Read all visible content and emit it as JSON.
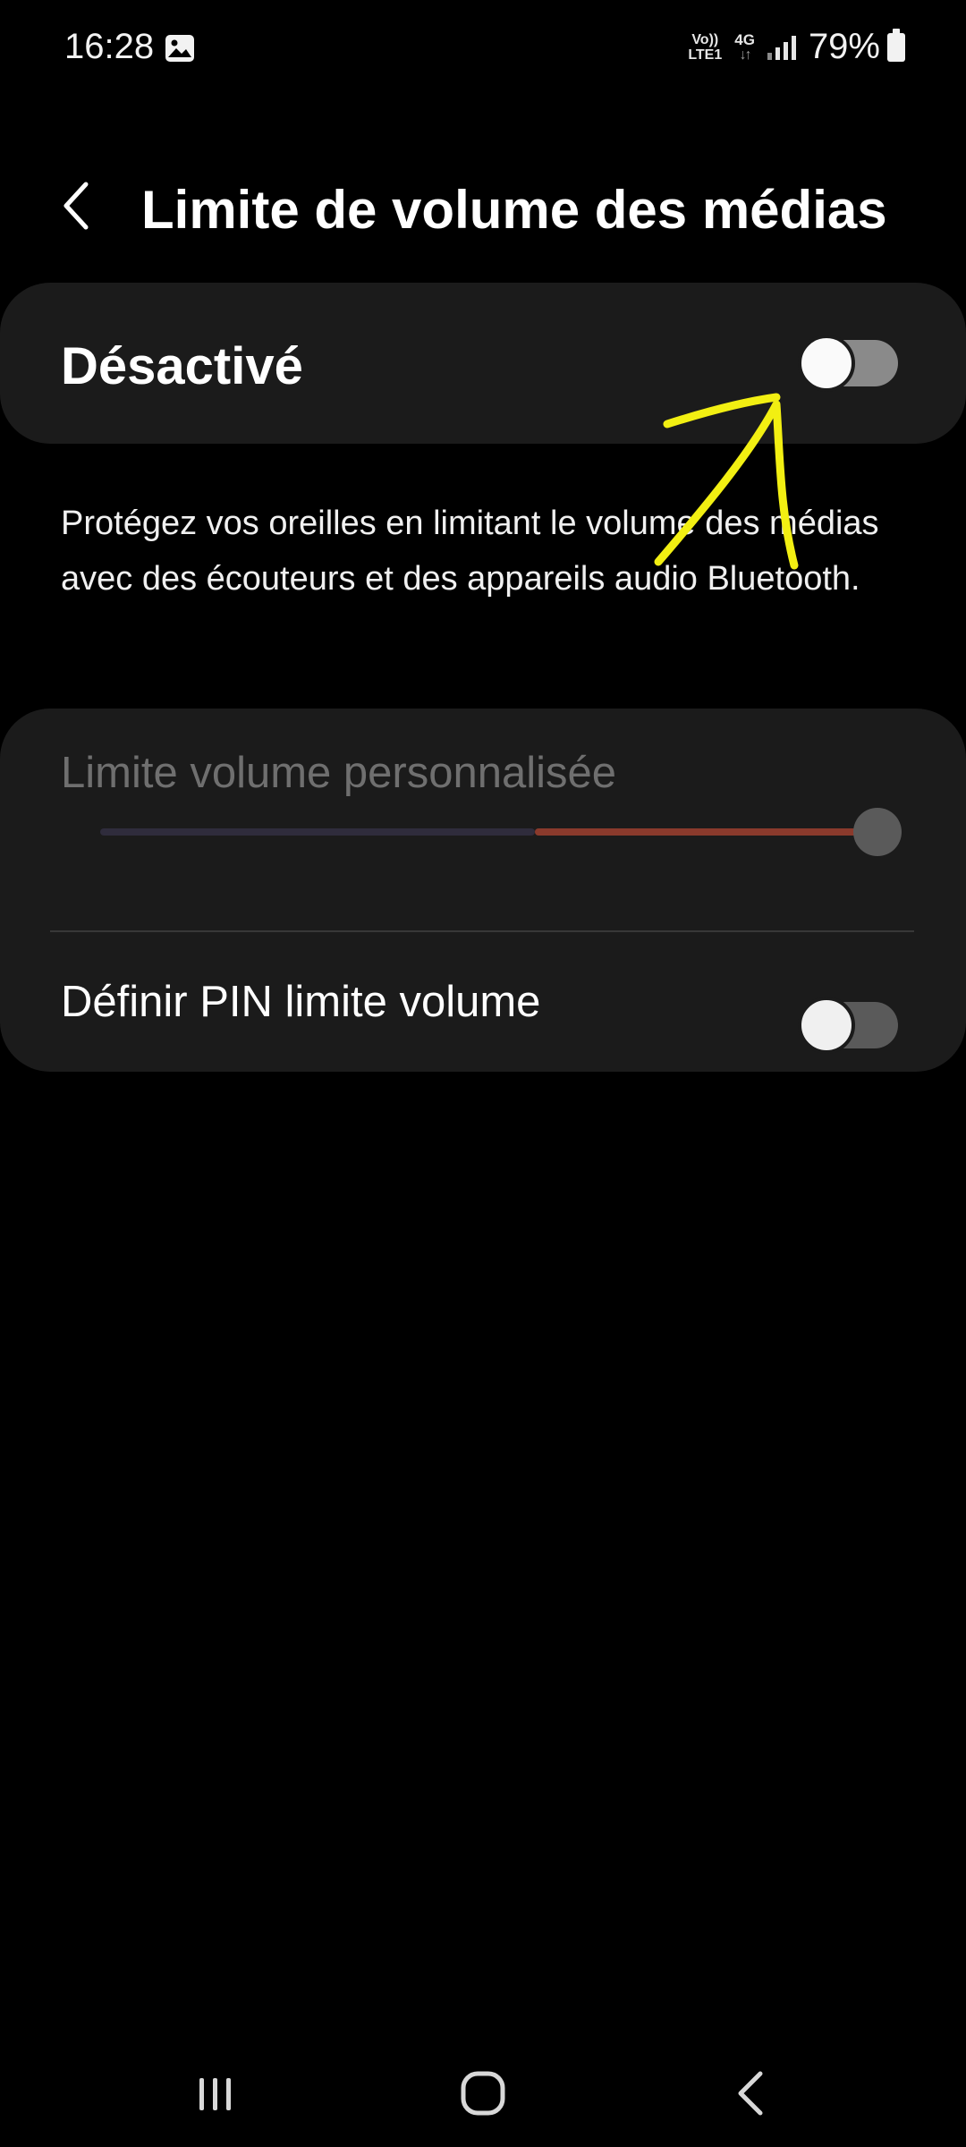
{
  "status_bar": {
    "time": "16:28",
    "volte_line1": "Vo))",
    "volte_line2": "LTE1",
    "network": "4G",
    "battery": "79%",
    "icons": [
      "gallery-icon",
      "volte-icon",
      "network-4g-icon",
      "signal-icon",
      "battery-icon"
    ]
  },
  "header": {
    "title": "Limite de volume des médias",
    "back_icon": "chevron-left-icon"
  },
  "master": {
    "label": "Désactivé",
    "switch_on": false
  },
  "description": "Protégez vos oreilles en limitant le volume des médias avec des écouteurs et des appareils audio Bluetooth.",
  "settings": {
    "custom_limit_label": "Limite volume personnalisée",
    "custom_limit_enabled": false,
    "slider_value_fraction": 1.0,
    "pin_label": "Définir PIN limite volume",
    "pin_switch_on": false
  },
  "navigation": {
    "recents_icon": "recents-icon",
    "home_icon": "home-icon",
    "back_icon": "back-icon"
  },
  "colors": {
    "background": "#000000",
    "card": "#1b1b1b",
    "annotation": "#f2ef12",
    "slider_active": "#8a3a2c",
    "slider_inactive": "#2f2c3c"
  }
}
